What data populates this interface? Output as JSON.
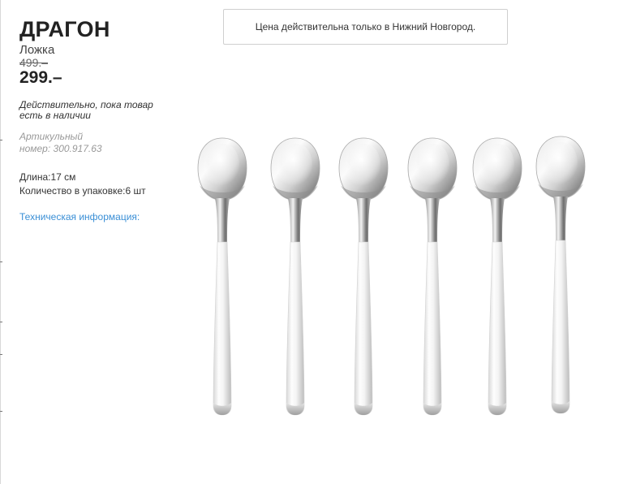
{
  "product": {
    "name": "ДРАГОН",
    "type": "Ложка",
    "old_price": "499.–",
    "new_price": "299.–",
    "availability": "Действительно, пока товар есть в наличии",
    "article_label": "Артикульный",
    "article_number": "номер: 300.917.63",
    "length": "Длина:17 см",
    "package_quantity": "Количество в упаковке:6 шт",
    "tech_info_link": "Техническая информация:"
  },
  "notice": {
    "text": "Цена действительна только в Нижний Новгород."
  },
  "image": {
    "subject": "six-spoons",
    "count": 6
  },
  "colors": {
    "link": "#3a8fd6",
    "muted": "#999999",
    "text": "#333333"
  }
}
